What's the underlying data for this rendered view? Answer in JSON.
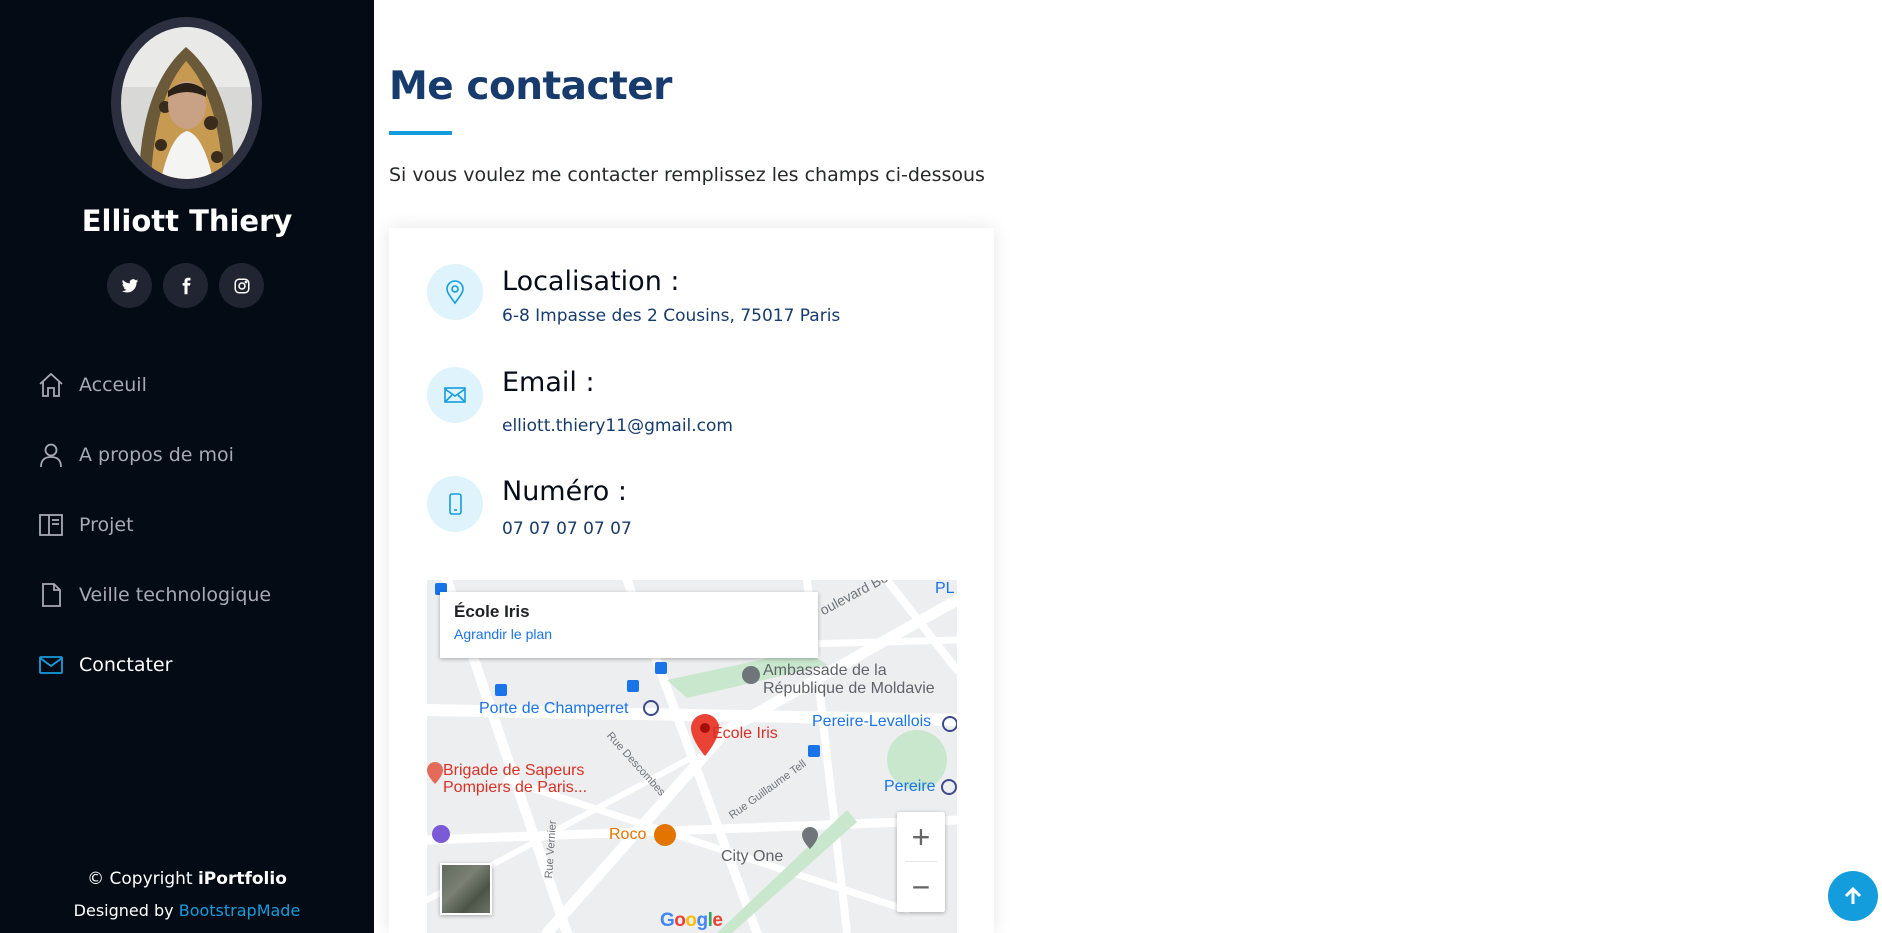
{
  "sidebar": {
    "profile_name": "Elliott Thiery",
    "socials": [
      {
        "icon": "twitter-icon"
      },
      {
        "icon": "facebook-icon"
      },
      {
        "icon": "instagram-icon"
      }
    ],
    "nav": [
      {
        "label": "Acceuil",
        "icon": "home-icon",
        "active": false
      },
      {
        "label": "A propos de moi",
        "icon": "person-icon",
        "active": false
      },
      {
        "label": "Projet",
        "icon": "book-icon",
        "active": false
      },
      {
        "label": "Veille technologique",
        "icon": "file-icon",
        "active": false
      },
      {
        "label": "Conctater",
        "icon": "envelope-icon",
        "active": true
      }
    ],
    "footer": {
      "copyright_prefix": "© Copyright ",
      "brand": "iPortfolio",
      "designed_by_prefix": "Designed by ",
      "designer": "BootstrapMade"
    }
  },
  "contact": {
    "title": "Me contacter",
    "description": "Si vous voulez me contacter remplissez les champs ci-dessous",
    "location_label": "Localisation :",
    "location_value": "6-8 Impasse des 2 Cousins, 75017 Paris",
    "email_label": "Email :",
    "email_value": "elliott.thiery11@gmail.com",
    "phone_label": "Numéro :",
    "phone_value": "07 07 07 07 07"
  },
  "map": {
    "place_name": "École Iris",
    "enlarge_link": "Agrandir le plan",
    "pin_label": "École Iris",
    "labels": {
      "embassy_1": "Ambassade de la",
      "embassy_2": "République de Moldavie",
      "porte": "Porte de Champerret",
      "pereire_levallois": "Pereire-Levallois",
      "pereire": "Pereire",
      "brigade_1": "Brigade de Sapeurs",
      "brigade_2": "Pompiers de Paris...",
      "roco": "Roco",
      "city_one": "City One",
      "boulevard": "oulevard Berthier",
      "rue_descombes": "Rue Descombes",
      "rue_guillaume": "Rue Guillaume Tell",
      "rue_vernier": "Rue Vernier",
      "pl": "PL"
    },
    "zoom_in": "+",
    "zoom_out": "−",
    "logo": "Google"
  },
  "colors": {
    "sidebar_bg": "#040b14",
    "accent": "#149ddd",
    "title": "#173b6c"
  }
}
